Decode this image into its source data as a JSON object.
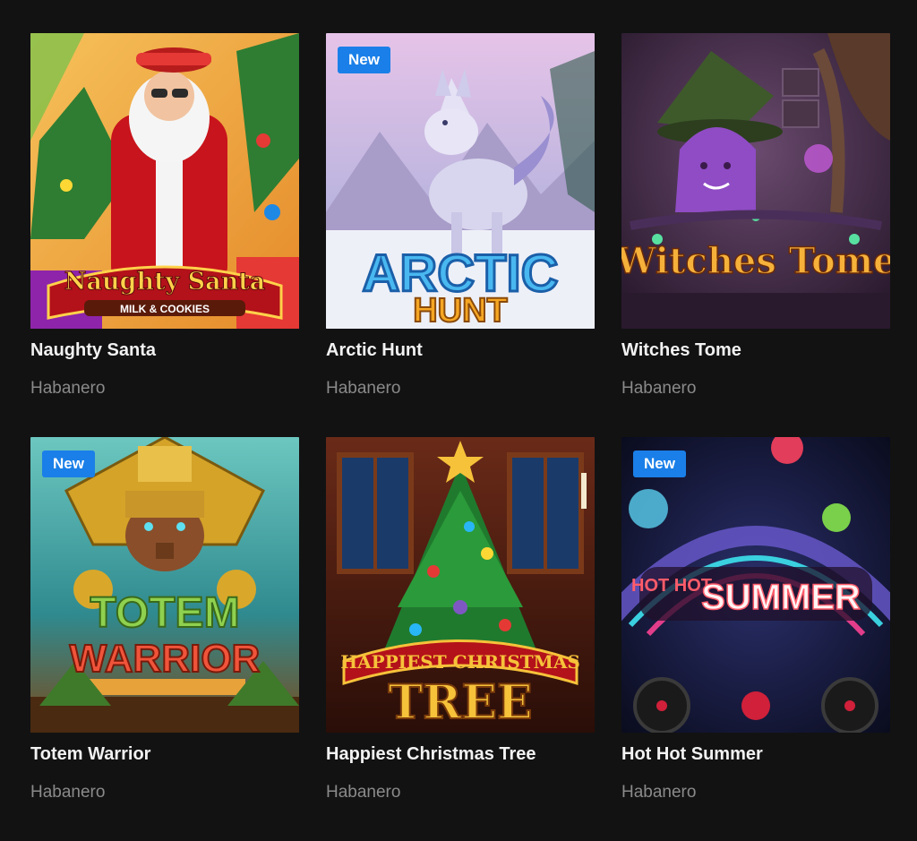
{
  "games": [
    {
      "title": "Naughty Santa",
      "provider": "Habanero",
      "badge": "",
      "art": {
        "logo_line1": "Naughty Santa",
        "logo_line2": "MILK & COOKIES",
        "colors": {
          "bg": "#f0a23a",
          "accent": "#c8141c",
          "logo": "#ffd24a"
        }
      }
    },
    {
      "title": "Arctic Hunt",
      "provider": "Habanero",
      "badge": "New",
      "art": {
        "logo_line1": "ARCTIC",
        "logo_line2": "HUNT",
        "colors": {
          "bg": "#c9b4e6",
          "accent": "#3fb6f2",
          "logo": "#f5a623"
        }
      }
    },
    {
      "title": "Witches Tome",
      "provider": "Habanero",
      "badge": "",
      "art": {
        "logo_line1": "Witches Tome",
        "logo_line2": "",
        "colors": {
          "bg": "#3d2a4a",
          "accent": "#8f4cc4",
          "logo": "#f5b13a"
        }
      }
    },
    {
      "title": "Totem Warrior",
      "provider": "Habanero",
      "badge": "New",
      "art": {
        "logo_line1": "TOTEM",
        "logo_line2": "WARRIOR",
        "colors": {
          "bg": "#3fa7a6",
          "accent": "#d4a328",
          "logo": "#8fd14f"
        }
      }
    },
    {
      "title": "Happiest Christmas Tree",
      "provider": "Habanero",
      "badge": "",
      "art": {
        "logo_line1": "HAPPIEST CHRISTMAS",
        "logo_line2": "TREE",
        "colors": {
          "bg": "#5a1a12",
          "accent": "#1f7a2e",
          "logo": "#f6c23a"
        }
      }
    },
    {
      "title": "Hot Hot Summer",
      "provider": "Habanero",
      "badge": "New",
      "art": {
        "logo_line1": "HOT HOT",
        "logo_line2": "SUMMER",
        "colors": {
          "bg": "#141a3a",
          "accent": "#e23d8a",
          "logo": "#ff5c6a"
        }
      }
    }
  ]
}
